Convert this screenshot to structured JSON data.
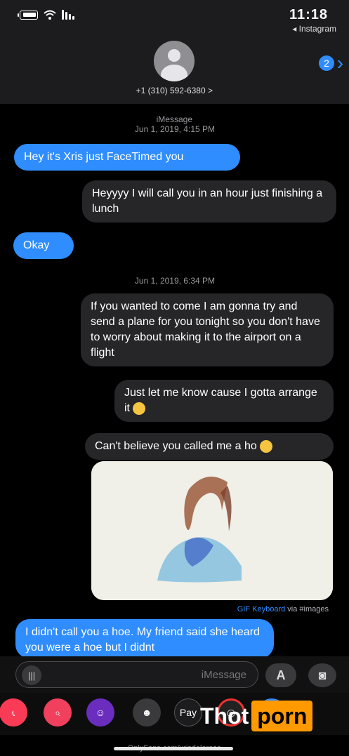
{
  "status_bar": {
    "time": "11:18",
    "back_app": "◂ Instagram"
  },
  "header": {
    "back_badge": "2",
    "contact": "+1 (310) 592-6380 >"
  },
  "thread": {
    "service": "iMessage",
    "date_1": "Jun 1, 2019, 4:15 PM",
    "date_2": "Jun 1, 2019, 6:34 PM",
    "messages": [
      {
        "from": "me",
        "text": "Hey it's Xris just FaceTimed you"
      },
      {
        "from": "them",
        "text": "Heyyyy I will call you in an hour just finishing a lunch"
      },
      {
        "from": "me",
        "text": "Okay"
      },
      {
        "from": "them",
        "text": "If you wanted to come I am gonna try and send a plane for you tonight so you don't have to worry about making it to the airport on a flight"
      },
      {
        "from": "them",
        "text": "Just let me know cause I gotta arrange it"
      },
      {
        "from": "them",
        "text": "Can't believe you called me a ho"
      },
      {
        "from": "me",
        "text": "I didn't call you a hoe. My friend said she heard you were a hoe but I didnt"
      }
    ],
    "gif_credit_app": "GIF Keyboard",
    "gif_credit_rest": " via #images"
  },
  "compose": {
    "placeholder": "iMessage"
  },
  "tray": [
    "music",
    "search",
    "memoji-1",
    "memoji-2",
    "apple-pay",
    "activity",
    "extra"
  ],
  "tray_labels": {
    "pay": "Pay"
  },
  "footer": {
    "url": "OnlyFans.com/xrisdelarosa"
  },
  "watermark": {
    "left": "Thot",
    "right": "porn"
  },
  "colors": {
    "blue": "#2f8dff",
    "gray_bubble": "#262628",
    "watermark_orange": "#ff9900"
  }
}
